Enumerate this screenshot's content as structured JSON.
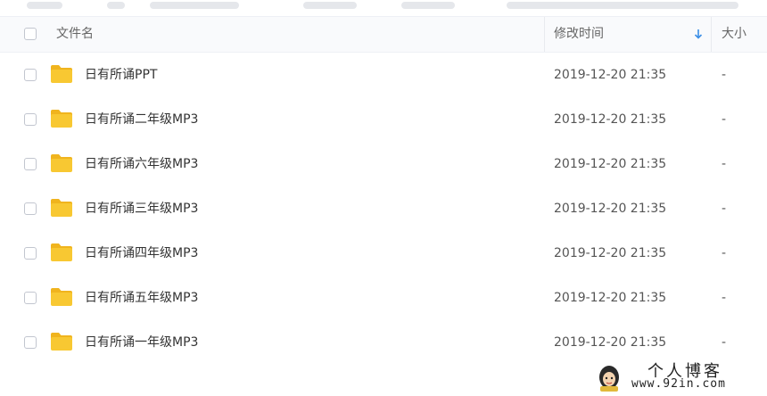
{
  "header": {
    "filename_label": "文件名",
    "modified_label": "修改时间",
    "size_label": "大小"
  },
  "files": [
    {
      "name": "日有所诵PPT",
      "modified": "2019-12-20 21:35",
      "size": "-"
    },
    {
      "name": "日有所诵二年级MP3",
      "modified": "2019-12-20 21:35",
      "size": "-"
    },
    {
      "name": "日有所诵六年级MP3",
      "modified": "2019-12-20 21:35",
      "size": "-"
    },
    {
      "name": "日有所诵三年级MP3",
      "modified": "2019-12-20 21:35",
      "size": "-"
    },
    {
      "name": "日有所诵四年级MP3",
      "modified": "2019-12-20 21:35",
      "size": "-"
    },
    {
      "name": "日有所诵五年级MP3",
      "modified": "2019-12-20 21:35",
      "size": "-"
    },
    {
      "name": "日有所诵一年级MP3",
      "modified": "2019-12-20 21:35",
      "size": "-"
    }
  ],
  "icons": {
    "folder": "folder-icon",
    "sort": "sort-down-arrow-icon",
    "watermark_logo": "avatar-logo-icon"
  },
  "colors": {
    "folder": "#f8c832",
    "folder_tab": "#f0b41e",
    "sort_arrow": "#3a8ee6",
    "header_bg": "#f9fafc"
  },
  "watermark": {
    "title": "个人博客",
    "site": "www.92in.com"
  }
}
